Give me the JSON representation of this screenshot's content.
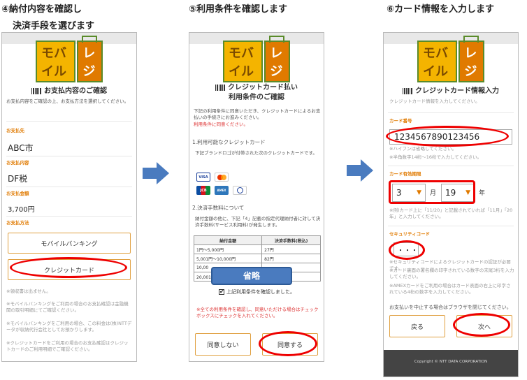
{
  "steps": {
    "step4_line1": "④納付内容を確認し",
    "step4_line2": "決済手段を選びます",
    "step5": "⑤利用条件を確認します",
    "step6": "⑥カード情報を入力します"
  },
  "logo_text": {
    "main": "モバイル",
    "sub": "レジ"
  },
  "panel1": {
    "title": "お支払内容のご確認",
    "intro": "お支払内容をご確認の上、お支払方法を選択してください。",
    "payee_label": "お支払先",
    "payee_value": "ABC市",
    "content_label": "お支払内容",
    "content_value": "DF税",
    "amount_label": "お支払金額",
    "amount_value": "3,700円",
    "method_label": "お支払方法",
    "btn_mobile_banking": "モバイルバンキング",
    "btn_credit": "クレジットカード",
    "note1": "※領収書は出ません。",
    "note2": "※モバイルバンキングをご利用の場合のお支払確認は金融機関の取引明細にてご確認ください。",
    "note3": "※モバイルバンキングをご利用の場合、この料金は(株)NTTデータが収納代行会社としてお預かりします。",
    "note4": "※クレジットカードをご利用の場合のお支払確認はクレジットカードのご利用明細でご確認ください。"
  },
  "panel2": {
    "title_line1": "クレジットカード払い",
    "title_line2": "利用条件のご確認",
    "intro": "下記の利用条件に同意いただき、クレジットカードによるお支払いの手続きにお進みください。",
    "intro_red": "利用条件に同意ください。",
    "sec1": "1.利用可能なクレジットカード",
    "sec1_text": "下記ブランドロゴが付帯された次のクレジットカードです。",
    "brands": [
      "VISA",
      "MC",
      "JCB",
      "AMEX",
      "Diners"
    ],
    "sec2": "2.決済手数料について",
    "sec2_text": "納付金額の他に、下記「4」記載の指定代理納付者に対して決済手数料(サービス利用料)が発生します。",
    "table_headers": [
      "納付金額",
      "決済手数料(税込)"
    ],
    "table_rows": [
      [
        "1円〜5,000円",
        "27円"
      ],
      [
        "5,001円〜10,000円",
        "82円"
      ],
      [
        "10,00",
        ""
      ],
      [
        "20,001円〜30",
        ""
      ]
    ],
    "omit_label": "省略",
    "checkbox_label": "上記利用条件を確認しました。",
    "warning": "※全ての利用条件を確認し、同意いただける場合はチェックボックスにチェックを入れてください。",
    "btn_disagree": "同意しない",
    "btn_agree": "同意する"
  },
  "panel3": {
    "title": "クレジットカード情報入力",
    "intro": "クレジットカード情報を入力してください。",
    "card_no_label": "カード番号",
    "card_no_value": "1234567890123456",
    "card_no_note1": "※ハイフンは省略してください。",
    "card_no_note2": "※半角数字14桁〜16桁で入力してください。",
    "expiry_label": "カード有効期限",
    "expiry_month": "3",
    "expiry_month_unit": "月",
    "expiry_year": "19",
    "expiry_year_unit": "年",
    "expiry_note": "※例)カード上に「11/20」と記載されていれば「11月」「20年」と入力してください。",
    "security_label": "セキュリティコード",
    "security_value": "・・・",
    "sec_note1": "※セキュリティコードによるクレジットカードの認証が必要です。",
    "sec_note2": "※カード裏面の署名欄の印字されている数字の末尾3桁を入力してください。",
    "sec_note3": "※AMEXカードをご利用の場合はカード表面の右上に印字されている4桁の数字を入力してください。",
    "cancel_note": "お支払いを中止する場合はブラウザを閉じてください。",
    "btn_back": "戻る",
    "btn_next": "次へ",
    "copyright": "Copyright © NTT DATA CORPORATION"
  }
}
